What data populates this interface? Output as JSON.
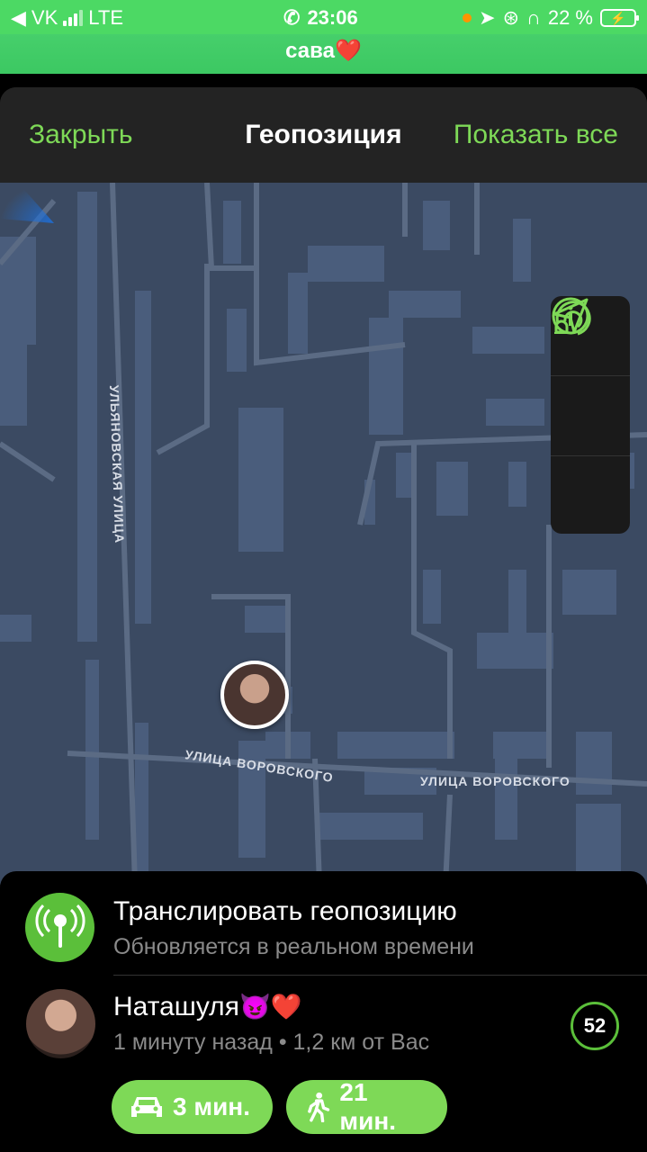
{
  "status_bar": {
    "carrier": "VK",
    "network": "LTE",
    "time": "23:06",
    "battery_percent": "22 %"
  },
  "chat_header": {
    "title": "сава",
    "emoji": "❤️"
  },
  "navbar": {
    "close_label": "Закрыть",
    "title": "Геопозиция",
    "show_all_label": "Показать все"
  },
  "map": {
    "street_labels": [
      "УЛЬЯНОВСКАЯ УЛИЦА",
      "УЛИЦА ВОРОВСКОГО",
      "УЛИЦА ВОРОВСКОГО"
    ],
    "tools": [
      "info-icon",
      "location-arrow-icon",
      "proximity-alert-icon"
    ]
  },
  "live_location": {
    "title": "Транслировать геопозицию",
    "subtitle": "Обновляется в реальном времени"
  },
  "contact": {
    "name": "Наташуля",
    "emojis": "😈❤️",
    "last_seen": "1 минуту назад",
    "distance": "1,2 км от Вас",
    "timer": "52"
  },
  "directions": {
    "car_label": "3 мин.",
    "walk_label": "21 мин."
  },
  "colors": {
    "accent": "#7ed957",
    "status_green": "#4cd964",
    "map_bg": "#3b4a62"
  }
}
